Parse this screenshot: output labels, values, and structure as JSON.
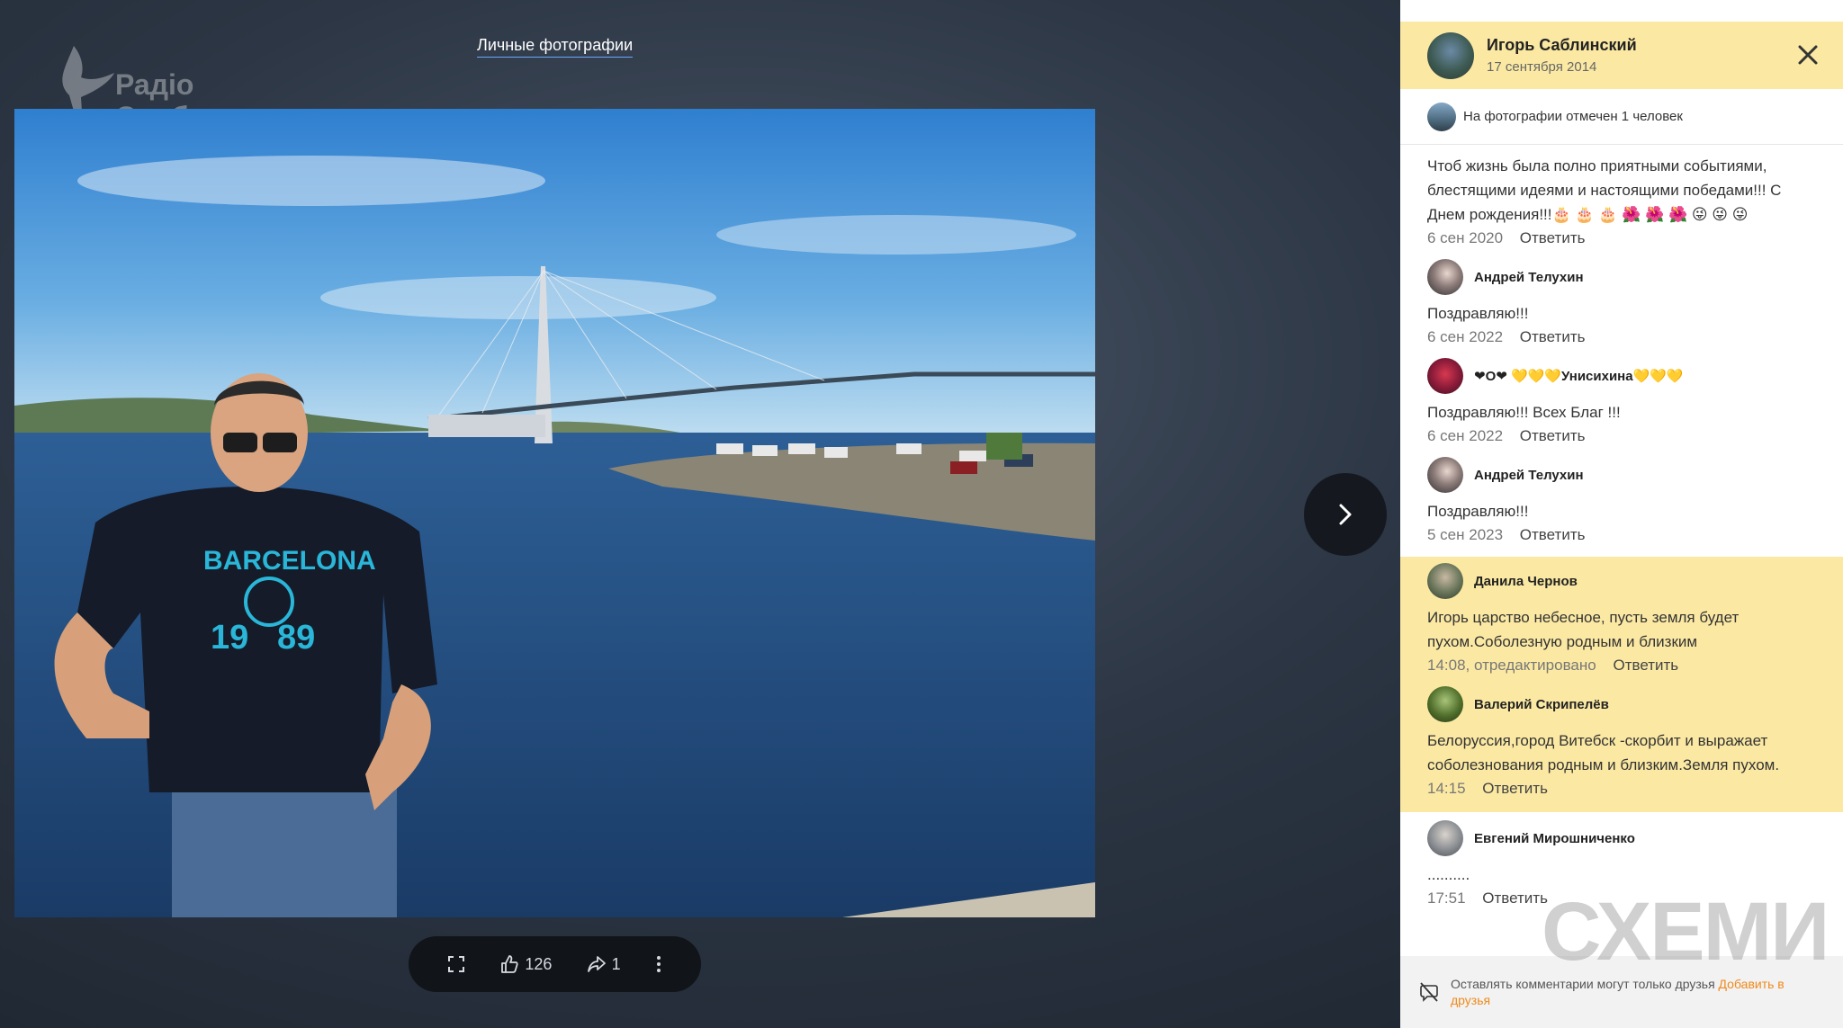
{
  "viewer": {
    "album_title": "Личные фотографии",
    "watermark_text": "Радіо\nСвобода",
    "toolbar": {
      "likes": "126",
      "shares": "1"
    },
    "photo_shirt_text": "BARCELONA",
    "photo_shirt_num": "19   89"
  },
  "panel": {
    "author_name": "Игорь Саблинский",
    "post_date": "17 сентября 2014",
    "tagged_text": "На фотографии отмечен 1 человек",
    "reply_label": "Ответить",
    "comments": [
      {
        "author": "",
        "text": "Чтоб жизнь была полно приятными событиями, блестящими идеями и настоящими победами!!! С Днем рождения!!!🎂 🎂 🎂 🌺 🌺 🌺 😜 😜 😜",
        "time": "6 сен 2020"
      },
      {
        "author": "Андрей Телухин",
        "text": "Поздравляю!!!",
        "time": "6 сен 2022"
      },
      {
        "author": "❤O❤ 💛💛💛Унисихина💛💛💛",
        "text": "Поздравляю!!! Всех Благ !!!",
        "time": "6 сен 2022"
      },
      {
        "author": "Андрей Телухин",
        "text": "Поздравляю!!!",
        "time": "5 сен 2023"
      },
      {
        "author": "Данила Чернов",
        "text": "Игорь царство небесное, пусть земля будет пухом.Соболезную родным и близким",
        "time": "14:08, отредактировано"
      },
      {
        "author": "Валерий Скрипелёв",
        "text": "Белоруссия,город Витебск -скорбит и выражает соболезнования родным и близким.Земля пухом.",
        "time": "14:15"
      },
      {
        "author": "Евгений Мирошниченко",
        "text": "..........",
        "time": "17:51"
      }
    ],
    "footer_text": "Оставлять комментарии могут только друзья",
    "footer_link": "Добавить в друзья"
  },
  "schemy_watermark": "СХЕМИ",
  "colors": {
    "highlight": "#fbe9a3",
    "link_orange": "#f08a1c",
    "toolbar_bg": "#111419"
  }
}
